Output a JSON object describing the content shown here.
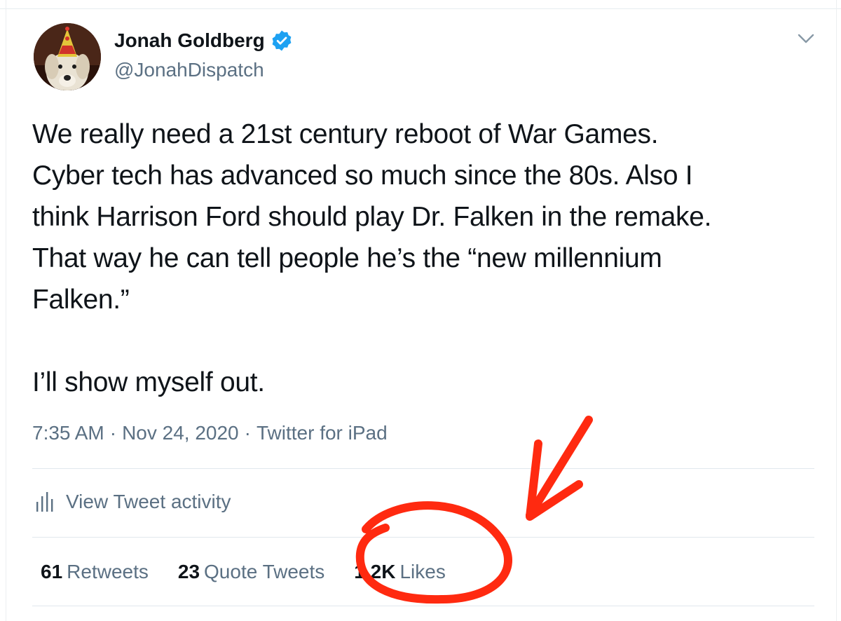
{
  "author": {
    "name": "Jonah Goldberg",
    "handle": "@JonahDispatch",
    "verified_icon": "verified-badge-icon",
    "avatar_icon": "dog-with-party-hat-avatar"
  },
  "tweet": {
    "lines": [
      "We really need a 21st century reboot of War Games.",
      "Cyber tech has advanced so much since the 80s. Also I",
      "think Harrison Ford should play Dr. Falken in the remake.",
      "That way he can tell people he’s the “new millennium",
      "Falken.”"
    ],
    "closing": "I’ll show myself out."
  },
  "meta": {
    "time": "7:35 AM",
    "date": "Nov 24, 2020",
    "client": "Twitter for iPad",
    "separator": "·"
  },
  "activity": {
    "label": "View Tweet activity",
    "icon": "bar-chart-icon"
  },
  "stats": {
    "retweets": {
      "count": "61",
      "label": "Retweets"
    },
    "quotes": {
      "count": "23",
      "label": "Quote Tweets"
    },
    "likes": {
      "count": "1.2K",
      "label": "Likes"
    }
  },
  "colors": {
    "text_primary": "#0f1419",
    "text_secondary": "#5b7083",
    "verified_blue": "#1da1f2",
    "annotation_red": "#ff2a10",
    "divider": "#e1e8ed"
  }
}
